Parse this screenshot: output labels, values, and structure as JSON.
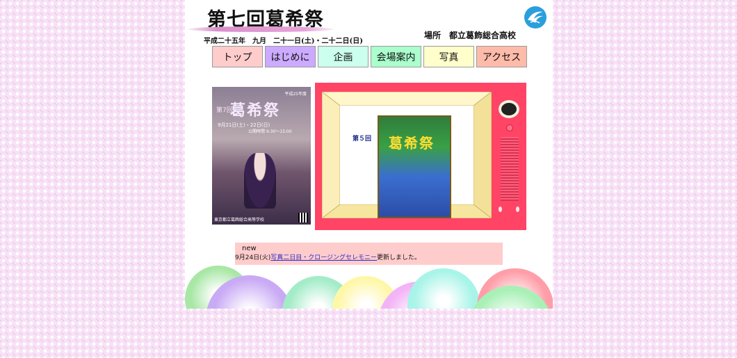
{
  "header": {
    "title": "第七回葛希祭",
    "date": "平成二十五年　九月　二十一日(土)・二十二日(日)",
    "venue": "場所　都立葛飾総合高校"
  },
  "nav": {
    "items": [
      {
        "label": "トップ",
        "color": "#ffcccc"
      },
      {
        "label": "はじめに",
        "color": "#ccaaff"
      },
      {
        "label": "企画",
        "color": "#ccffee"
      },
      {
        "label": "会場案内",
        "color": "#aaffcc"
      },
      {
        "label": "写真",
        "color": "#ffffcc"
      },
      {
        "label": "アクセス",
        "color": "#ffbbaa"
      }
    ]
  },
  "poster": {
    "year": "平成25年度",
    "edition": "第7回",
    "title": "葛希祭",
    "dates": "9月21日(土)・22日(日)",
    "hours": "公開時間 9:30～15:00",
    "school": "東京都立葛飾総合高等学校"
  },
  "tv": {
    "episode": "第５回",
    "poster_title": "葛希祭",
    "color": "#ff4466"
  },
  "news": {
    "heading": "new",
    "date": "9月24日(火)",
    "link": "写真二日目・クロージングセレモニー",
    "suffix": "更新しました。"
  },
  "decor": {
    "circle_colors": [
      "#a9e7a6",
      "#c9aaf5",
      "#a3ecc8",
      "#fff7a8",
      "#f3b3f6",
      "#a8f4e8",
      "#ff9ea8",
      "#a8f0b6"
    ]
  }
}
